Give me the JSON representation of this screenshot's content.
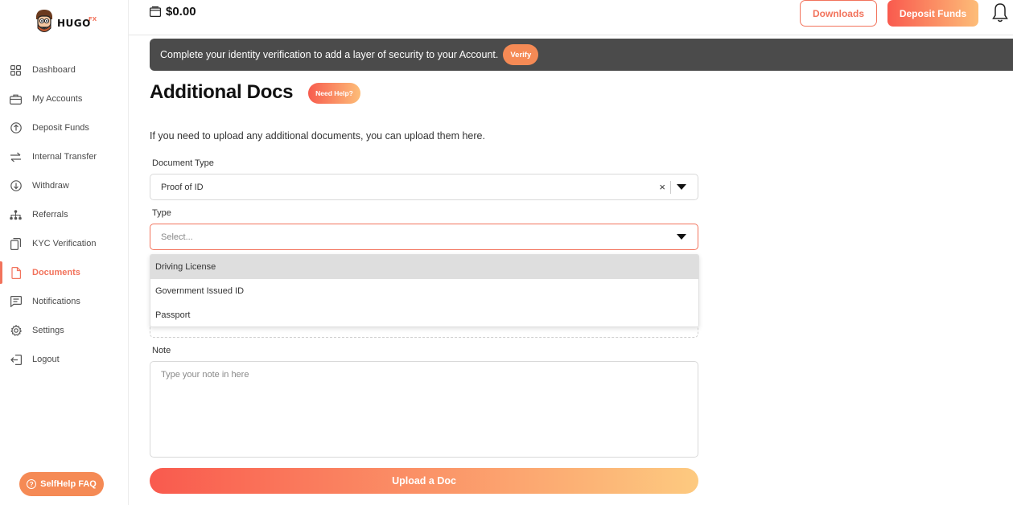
{
  "brand": {
    "name": "HUGO",
    "suffix": "FX"
  },
  "header": {
    "balance": "$0.00",
    "downloads_label": "Downloads",
    "deposit_label": "Deposit Funds"
  },
  "sidebar": {
    "items": [
      {
        "label": "Dashboard",
        "icon": "grid-icon"
      },
      {
        "label": "My Accounts",
        "icon": "briefcase-icon"
      },
      {
        "label": "Deposit Funds",
        "icon": "arrow-up-circle-icon"
      },
      {
        "label": "Internal Transfer",
        "icon": "transfer-arrows-icon"
      },
      {
        "label": "Withdraw",
        "icon": "arrow-down-circle-icon"
      },
      {
        "label": "Referrals",
        "icon": "network-icon"
      },
      {
        "label": "KYC Verification",
        "icon": "copy-icon"
      },
      {
        "label": "Documents",
        "icon": "file-icon",
        "active": true
      },
      {
        "label": "Notifications",
        "icon": "message-icon"
      },
      {
        "label": "Settings",
        "icon": "gear-icon"
      },
      {
        "label": "Logout",
        "icon": "logout-icon"
      }
    ],
    "faq_label": "SelfHelp FAQ"
  },
  "banner": {
    "text": "Complete your identity verification to add a layer of security to your Account.",
    "verify_label": "Verify"
  },
  "page": {
    "title": "Additional Docs",
    "help_label": "Need Help?",
    "intro": "If you need to upload any additional documents, you can upload them here."
  },
  "form": {
    "document_type": {
      "label": "Document Type",
      "value": "Proof of ID",
      "clear": "×"
    },
    "type": {
      "label": "Type",
      "placeholder": "Select...",
      "options": [
        "Driving License",
        "Government Issued ID",
        "Passport"
      ]
    },
    "note": {
      "label": "Note",
      "placeholder": "Type your note in here"
    },
    "submit_label": "Upload a Doc"
  },
  "colors": {
    "accent": "#f2735c",
    "banner_bg": "#4b4b4b",
    "gradient_start": "#f95a4e",
    "gradient_end": "#fdbd78"
  }
}
